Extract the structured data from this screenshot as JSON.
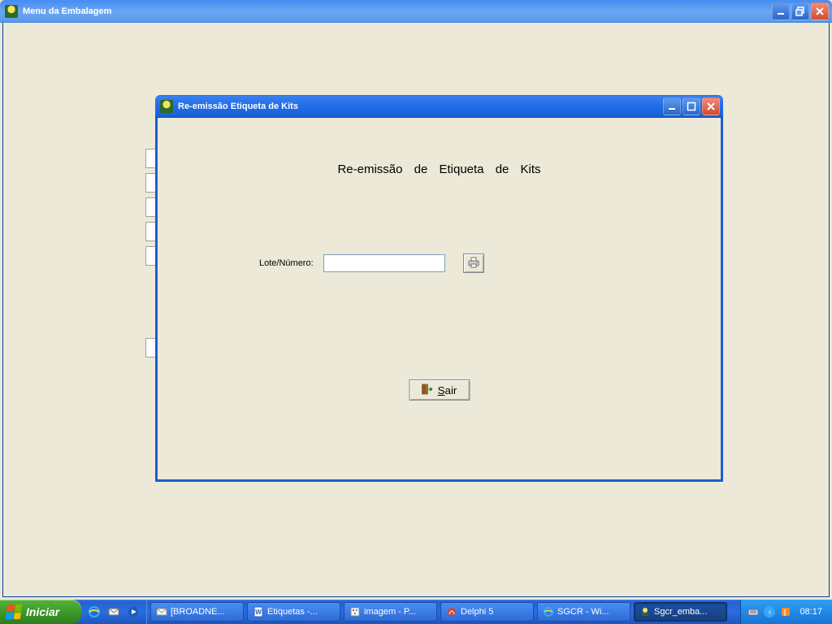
{
  "parent_window": {
    "title": "Menu da Embalagem"
  },
  "dialog": {
    "title": "Re-emissão Etiqueta de Kits",
    "heading": "Re-emissão de Etiqueta de Kits",
    "lote_label": "Lote/Número:",
    "lote_value": "",
    "exit_label": "Sair"
  },
  "taskbar": {
    "start": "Iniciar",
    "tasks": [
      {
        "label": "[BROADNE...",
        "active": false
      },
      {
        "label": "Etiquetas -...",
        "active": false
      },
      {
        "label": "imagem - P...",
        "active": false
      },
      {
        "label": "Delphi 5",
        "active": false
      },
      {
        "label": "SGCR - Wi...",
        "active": false
      },
      {
        "label": "Sgcr_emba...",
        "active": true
      }
    ],
    "clock": "08:17"
  }
}
